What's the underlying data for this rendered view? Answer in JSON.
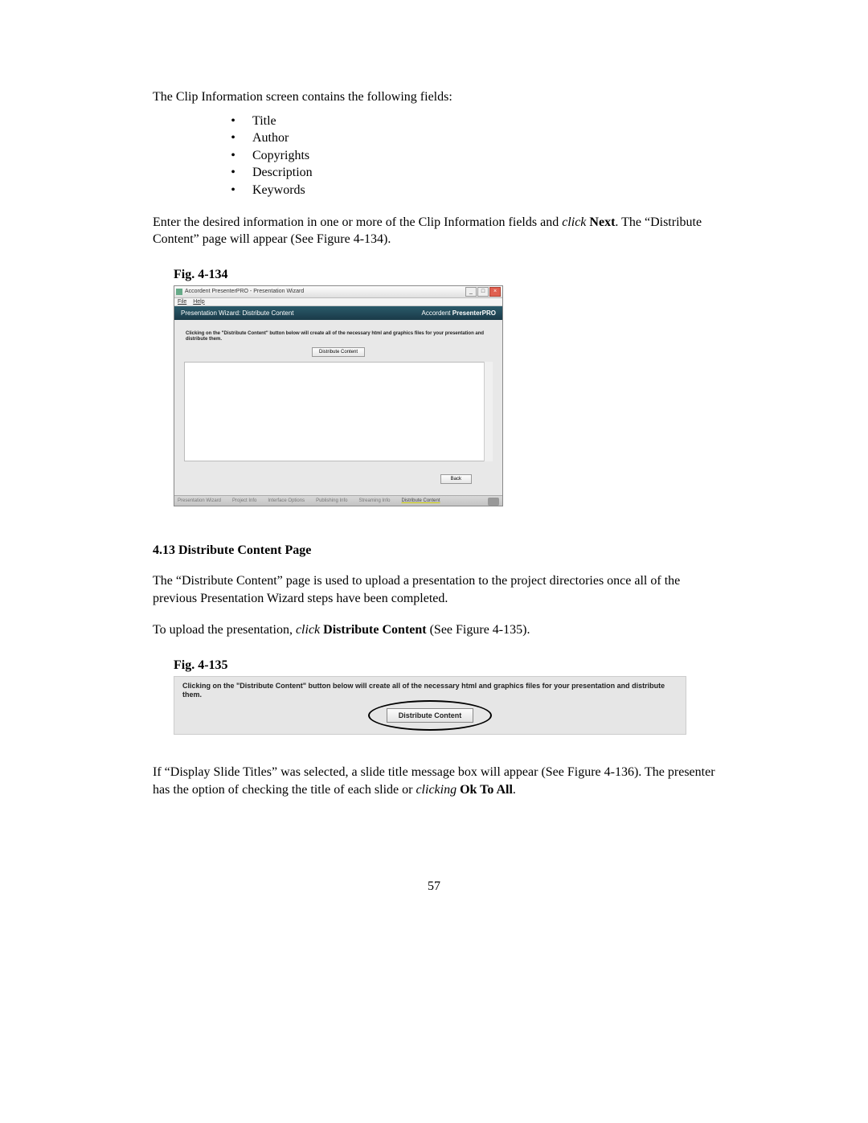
{
  "intro_line": "The Clip Information screen contains the following fields:",
  "bullets": [
    "Title",
    "Author",
    "Copyrights",
    "Description",
    "Keywords"
  ],
  "para2_pre": "Enter the desired information in one or more of the Clip Information fields and ",
  "para2_italic": "click",
  "para2_bold": " Next",
  "para2_post": ". The “Distribute Content” page will appear (See Figure 4-134).",
  "fig134_caption": "Fig. 4-134",
  "fig134": {
    "window_title": "Accordent PresenterPRO - Presentation Wizard",
    "menu_file": "File",
    "menu_help": "Help",
    "banner_left": "Presentation Wizard: Distribute Content",
    "banner_brand_pre": "Accordent ",
    "banner_brand_bold": "PresenterPRO",
    "instruction": "Clicking on the \"Distribute Content\" button below will create all of the necessary html and graphics files for your presentation and distribute them.",
    "distribute_btn": "Distribute Content",
    "back_btn": "Back",
    "status_items": [
      "Presentation Wizard",
      "Project Info",
      "Interface Options",
      "Publishing Info",
      "Streaming Info",
      "Distribute Content"
    ]
  },
  "section_heading": "4.13  Distribute Content Page",
  "para3": "The “Distribute Content” page is used to upload a presentation to the project directories once all of the previous Presentation Wizard steps have been completed.",
  "para4_pre": "To upload the presentation, ",
  "para4_italic": "click",
  "para4_bold": " Distribute Content",
  "para4_post": " (See Figure 4-135).",
  "fig135_caption": "Fig. 4-135",
  "fig135": {
    "instruction": "Clicking on the \"Distribute Content\" button below will create all of the necessary html and graphics files for your presentation and distribute them.",
    "distribute_btn": "Distribute Content"
  },
  "para5_pre": "If “Display Slide Titles” was selected, a slide title message box will appear (See Figure 4-136).  The presenter has the option of checking the title of each slide or ",
  "para5_italic": "clicking",
  "para5_bold": " Ok To All",
  "para5_post": ".",
  "page_number": "57"
}
